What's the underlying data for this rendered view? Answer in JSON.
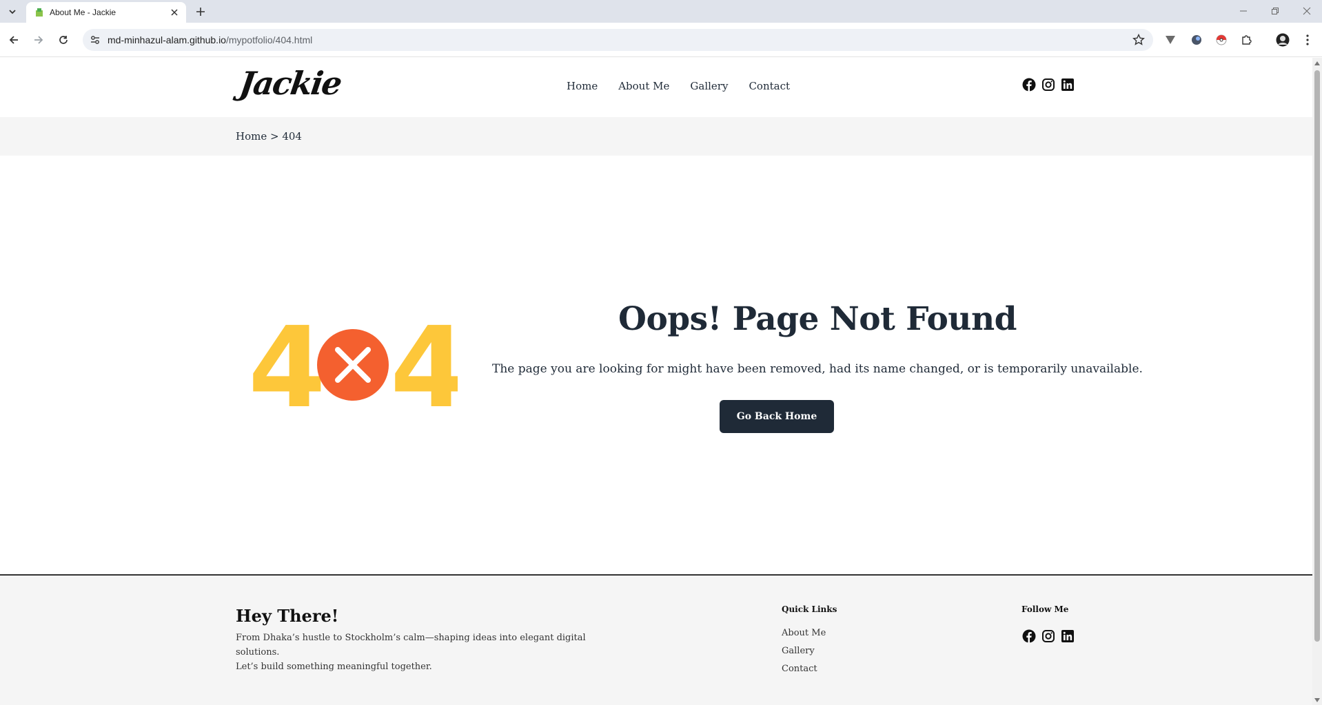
{
  "browser": {
    "tab_title": "About Me - Jackie",
    "url_host": "md-minhazul-alam.github.io",
    "url_path": "/mypotfolio/404.html"
  },
  "header": {
    "logo": "Jackie",
    "nav": [
      "Home",
      "About Me",
      "Gallery",
      "Contact"
    ],
    "social_icons": [
      "facebook-icon",
      "instagram-icon",
      "linkedin-icon"
    ]
  },
  "breadcrumb": "Home > 404",
  "error": {
    "code_left": "4",
    "code_right": "4",
    "title": "Oops! Page Not Found",
    "message": "The page you are looking for might have been removed, had its name changed, or is temporarily unavailable.",
    "button": "Go Back Home"
  },
  "footer": {
    "title": "Hey There!",
    "desc_line1": "From Dhaka’s hustle to Stockholm’s calm—shaping ideas into elegant digital solutions.",
    "desc_line2": "Let’s build something meaningful together.",
    "quick_links_heading": "Quick Links",
    "quick_links": [
      "About Me",
      "Gallery",
      "Contact"
    ],
    "follow_heading": "Follow Me"
  },
  "colors": {
    "accent_yellow": "#fdc73a",
    "accent_red": "#f4602f",
    "dark": "#1f2a37"
  }
}
